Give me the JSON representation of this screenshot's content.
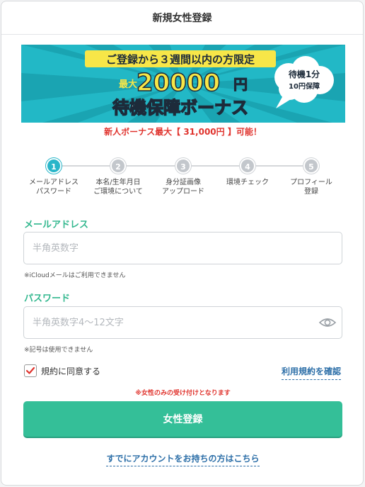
{
  "header": {
    "title": "新規女性登録"
  },
  "banner": {
    "headline": "ご登録から３週間以内の方限定",
    "max_prefix": "最大",
    "amount": "20000",
    "yen": "円",
    "bonus_name": "待機保障ボーナス",
    "bubble_line1": "待機1分",
    "bubble_line2": "10円保障",
    "colors": {
      "teal": "#22b8c6",
      "yellow": "#f7e648",
      "dark": "#1d2b3a"
    }
  },
  "bonus_text": "新人ボーナス最大【 31,000円 】可能！",
  "steps": [
    {
      "number": "1",
      "label": "メールアドレス\nパスワード",
      "active": true
    },
    {
      "number": "2",
      "label": "本名/生年月日\nご環境について",
      "active": false
    },
    {
      "number": "3",
      "label": "身分証画像\nアップロード",
      "active": false
    },
    {
      "number": "4",
      "label": "環境チェック",
      "active": false
    },
    {
      "number": "5",
      "label": "プロフィール\n登録",
      "active": false
    }
  ],
  "email": {
    "label": "メールアドレス",
    "placeholder": "半角英数字",
    "value": "",
    "note": "※iCloudメールはご利用できません"
  },
  "password": {
    "label": "パスワード",
    "placeholder": "半角英数字4〜12文字",
    "value": "",
    "note": "※記号は使用できません"
  },
  "agree": {
    "label": "規約に同意する",
    "checked": true
  },
  "terms_link": "利用規約を確認",
  "female_note": "※女性のみの受け付けとなります",
  "submit_label": "女性登録",
  "login_link": "すでにアカウントをお持ちの方はこちら",
  "colors": {
    "accent_green": "#34bf98",
    "step_active": "#29b6c9",
    "link_blue": "#2d6fa8",
    "alert_red": "#e0342e"
  }
}
